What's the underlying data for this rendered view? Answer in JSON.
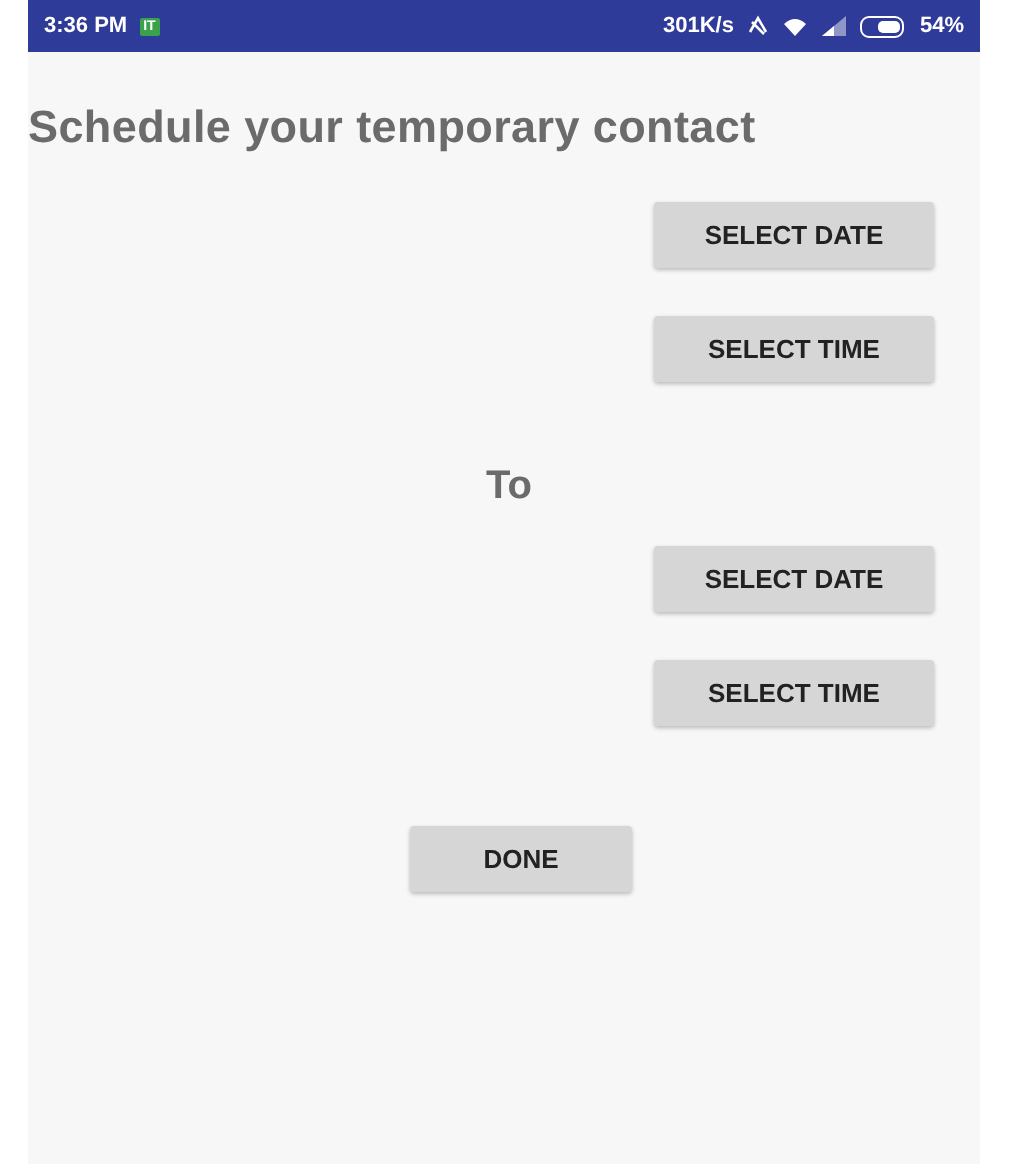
{
  "status_bar": {
    "time": "3:36 PM",
    "notification_badge": "IT",
    "speed": "301K/s",
    "battery": "54%"
  },
  "title": "Schedule your temporary contact",
  "from_buttons": [
    "SELECT DATE",
    "SELECT TIME"
  ],
  "separator": "To",
  "to_buttons": [
    "SELECT DATE",
    "SELECT TIME"
  ],
  "done_button": "DONE"
}
